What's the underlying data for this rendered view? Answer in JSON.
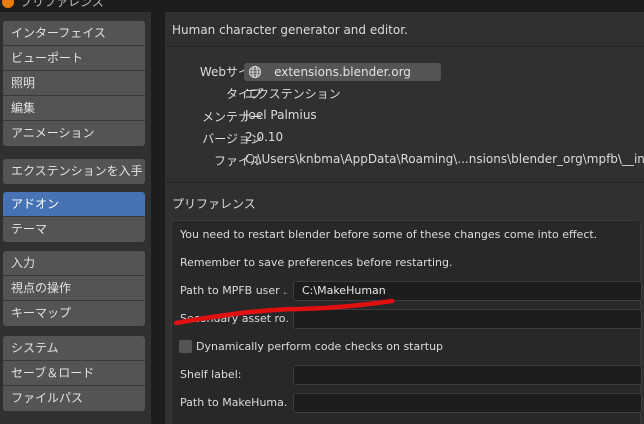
{
  "window": {
    "title": "プリファレンス"
  },
  "sidebar": {
    "groups": [
      {
        "items": [
          {
            "label": "インターフェイス",
            "active": false
          },
          {
            "label": "ビューポート",
            "active": false
          },
          {
            "label": "照明",
            "active": false
          },
          {
            "label": "編集",
            "active": false
          },
          {
            "label": "アニメーション",
            "active": false
          }
        ]
      },
      {
        "items": [
          {
            "label": "エクステンションを入手",
            "active": false
          }
        ]
      },
      {
        "items": [
          {
            "label": "アドオン",
            "active": true
          },
          {
            "label": "テーマ",
            "active": false
          }
        ]
      },
      {
        "items": [
          {
            "label": "入力",
            "active": false
          },
          {
            "label": "視点の操作",
            "active": false
          },
          {
            "label": "キーマップ",
            "active": false
          }
        ]
      },
      {
        "items": [
          {
            "label": "システム",
            "active": false
          },
          {
            "label": "セーブ＆ロード",
            "active": false
          },
          {
            "label": "ファイルパス",
            "active": false
          }
        ]
      }
    ]
  },
  "addon": {
    "description": "Human character generator and editor.",
    "website_label": "Webサイト",
    "website_link": "extensions.blender.org",
    "type_label": "タイプ",
    "type_value": "エクステンション",
    "maintainer_label": "メンテナー",
    "maintainer_value": "Joel Palmius",
    "version_label": "バージョン",
    "version_value": "2.0.10",
    "file_label": "ファイル",
    "file_value": "C:\\Users\\knbma\\AppData\\Roaming\\...nsions\\blender_org\\mpfb\\__init__.py"
  },
  "preferences": {
    "heading": "プリファレンス",
    "note_restart": "You need to restart blender before some of these changes come into effect.",
    "note_save": "Remember to save preferences before restarting.",
    "path_user_label": "Path to MPFB user ...",
    "path_user_value": "C:\\MakeHuman",
    "secondary_label": "Secondary asset ro...",
    "secondary_value": "",
    "code_checks_label": "Dynamically perform code checks on startup",
    "code_checks_checked": false,
    "shelf_label": "Shelf label:",
    "shelf_value": "",
    "makehuman_label": "Path to MakeHuma...",
    "makehuman_value": ""
  },
  "colors": {
    "background": "#303030",
    "button": "#545454",
    "active": "#4772b3",
    "field": "#1d1d1d",
    "annotation": "#e01010"
  }
}
